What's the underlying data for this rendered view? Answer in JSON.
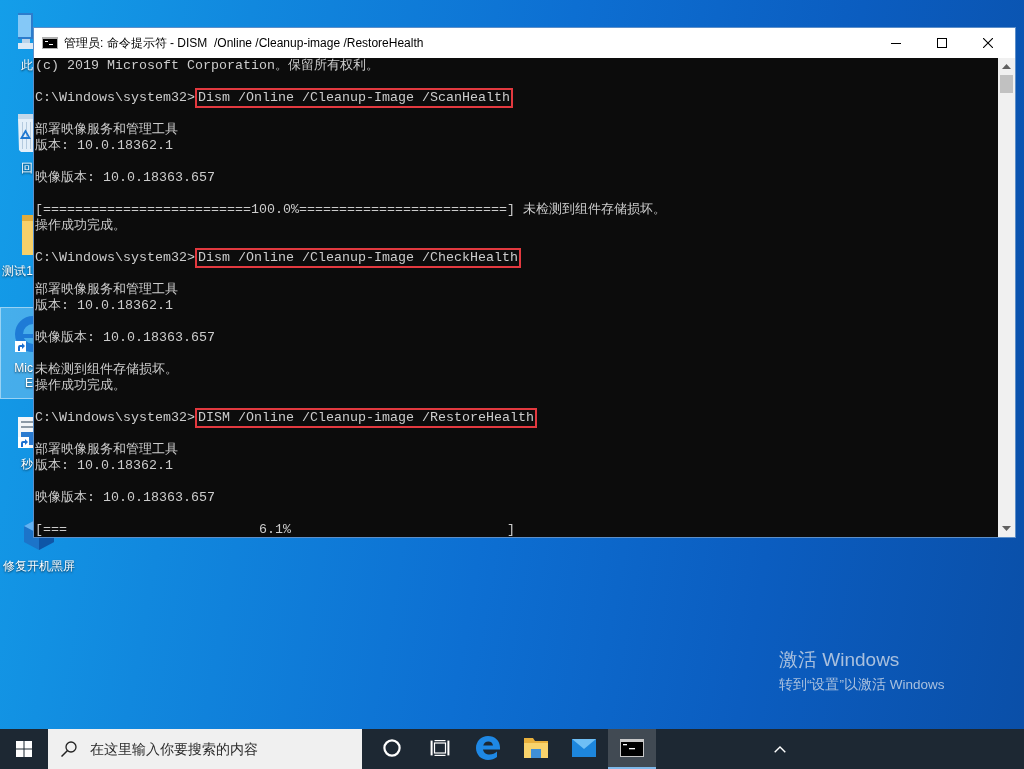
{
  "desktop_icons": [
    {
      "label": "此",
      "selected": false,
      "shortcut": false
    },
    {
      "label": "回",
      "selected": false,
      "shortcut": false
    },
    {
      "label": "测试1",
      "selected": false,
      "shortcut": false
    },
    {
      "label": "Mic\nE",
      "selected": true,
      "shortcut": true
    },
    {
      "label": "秒",
      "selected": false,
      "shortcut": true
    },
    {
      "label": "修复开机黑屏",
      "selected": false,
      "shortcut": false
    }
  ],
  "console_window": {
    "title": "管理员: 命令提示符 - DISM  /Online /Cleanup-image /RestoreHealth",
    "lines": [
      {
        "kind": "output",
        "text": "(c) 2019 Microsoft Corporation。保留所有权利。"
      },
      {
        "kind": "blank"
      },
      {
        "kind": "command",
        "prompt": "C:\\Windows\\system32>",
        "command": "Dism /Online /Cleanup-Image /ScanHealth",
        "highlighted": true
      },
      {
        "kind": "blank"
      },
      {
        "kind": "output",
        "text": "部署映像服务和管理工具"
      },
      {
        "kind": "output",
        "text": "版本: 10.0.18362.1"
      },
      {
        "kind": "blank"
      },
      {
        "kind": "output",
        "text": "映像版本: 10.0.18363.657"
      },
      {
        "kind": "blank"
      },
      {
        "kind": "output",
        "text": "[==========================100.0%==========================] 未检测到组件存储损坏。"
      },
      {
        "kind": "output",
        "text": "操作成功完成。"
      },
      {
        "kind": "blank"
      },
      {
        "kind": "command",
        "prompt": "C:\\Windows\\system32>",
        "command": "Dism /Online /Cleanup-Image /CheckHealth",
        "highlighted": true
      },
      {
        "kind": "blank"
      },
      {
        "kind": "output",
        "text": "部署映像服务和管理工具"
      },
      {
        "kind": "output",
        "text": "版本: 10.0.18362.1"
      },
      {
        "kind": "blank"
      },
      {
        "kind": "output",
        "text": "映像版本: 10.0.18363.657"
      },
      {
        "kind": "blank"
      },
      {
        "kind": "output",
        "text": "未检测到组件存储损坏。"
      },
      {
        "kind": "output",
        "text": "操作成功完成。"
      },
      {
        "kind": "blank"
      },
      {
        "kind": "command",
        "prompt": "C:\\Windows\\system32>",
        "command": "DISM /Online /Cleanup-image /RestoreHealth",
        "highlighted": true
      },
      {
        "kind": "blank"
      },
      {
        "kind": "output",
        "text": "部署映像服务和管理工具"
      },
      {
        "kind": "output",
        "text": "版本: 10.0.18362.1"
      },
      {
        "kind": "blank"
      },
      {
        "kind": "output",
        "text": "映像版本: 10.0.18363.657"
      },
      {
        "kind": "blank"
      },
      {
        "kind": "output",
        "text": "[===                        6.1%                           ]"
      }
    ]
  },
  "activation_notice": {
    "heading": "激活 Windows",
    "text": "转到“设置”以激活 Windows"
  },
  "taskbar": {
    "search": {
      "placeholder": "在这里输入你要搜索的内容"
    },
    "apps": [
      {
        "active": false
      },
      {
        "active": false
      },
      {
        "active": false
      },
      {
        "active": true
      }
    ]
  }
}
